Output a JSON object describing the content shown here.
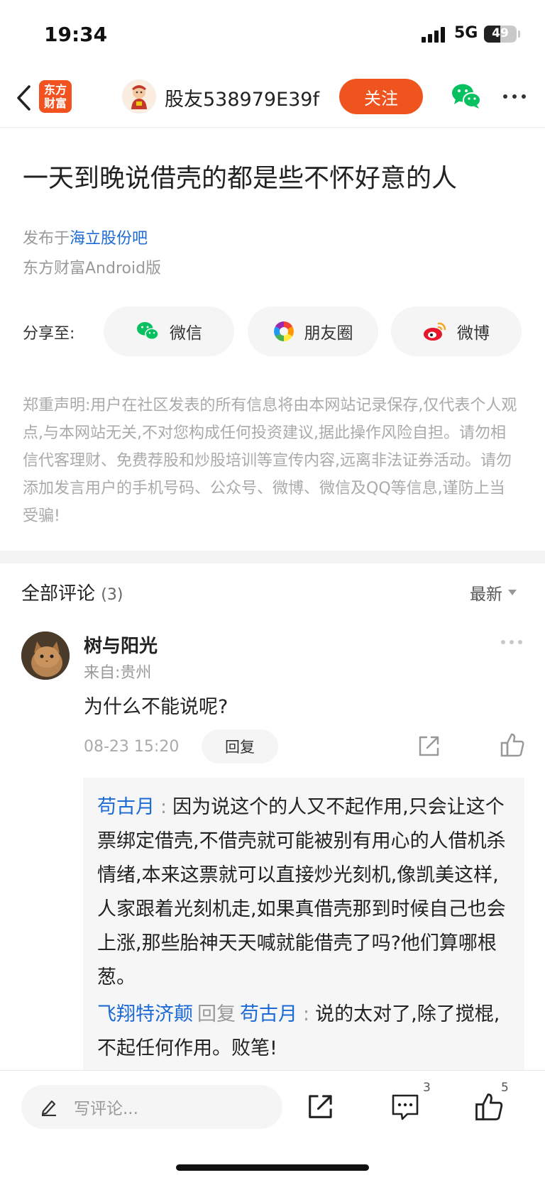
{
  "status_bar": {
    "time": "19:34",
    "network": "5G",
    "battery": "49",
    "battery_level": 0.49
  },
  "nav": {
    "logo_line1": "东方",
    "logo_line2": "财富",
    "username": "股友538979E39f",
    "follow_label": "关注"
  },
  "post": {
    "title": "一天到晚说借壳的都是些不怀好意的人",
    "published_prefix": "发布于",
    "forum": "海立股份吧",
    "source": "东方财富Android版"
  },
  "share": {
    "label": "分享至:",
    "wechat": "微信",
    "moments": "朋友圈",
    "weibo": "微博"
  },
  "disclaimer": "郑重声明:用户在社区发表的所有信息将由本网站记录保存,仅代表个人观点,与本网站无关,不对您构成任何投资建议,据此操作风险自担。请勿相信代客理财、免费荐股和炒股培训等宣传内容,远离非法证券活动。请勿添加发言用户的手机号码、公众号、微博、微信及QQ等信息,谨防上当受骗!",
  "comments": {
    "title": "全部评论",
    "count": "(3)",
    "sort": "最新",
    "items": [
      {
        "author": "树与阳光",
        "from": "来自:贵州",
        "text": "为什么不能说呢?",
        "time": "08-23 15:20",
        "reply_label": "回复",
        "replies": [
          {
            "author": "苟古月",
            "text": "因为说这个的人又不起作用,只会让这个票绑定借壳,不借壳就可能被别有用心的人借机杀情绪,本来这票就可以直接炒光刻机,像凯美这样,人家跟着光刻机走,如果真借壳那到时候自己也会上涨,那些胎神天天喊就能借壳了吗?他们算哪根葱。"
          },
          {
            "author": "飞翔特济颠",
            "reply_word": "回复",
            "target": "苟古月",
            "text": "说的太对了,除了搅棍,不起任何作用。败笔!"
          }
        ]
      }
    ]
  },
  "bottom_bar": {
    "placeholder": "写评论...",
    "comment_count": "3",
    "like_count": "5"
  },
  "colors": {
    "accent": "#f0541e",
    "link": "#1c6ad6",
    "wechat": "#07c160"
  }
}
